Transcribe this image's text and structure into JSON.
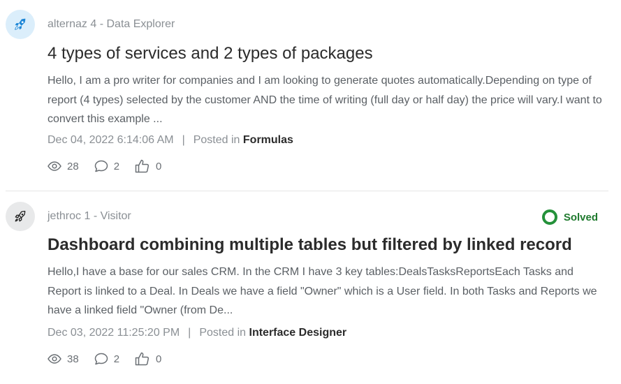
{
  "posts": [
    {
      "author": "alternaz 4 - Data Explorer",
      "title": "4 types of services and 2 types of packages",
      "excerpt": "Hello, I am a pro writer for companies and I am looking to generate quotes automatically.Depending on type of report (4 types) selected by the customer AND the time of writing (full day or half day) the price will vary.I want to convert this example ...",
      "date": "Dec 04, 2022 6:14:06 AM",
      "separator": "|",
      "posted_in_label": "Posted in",
      "category": "Formulas",
      "views": "28",
      "comments": "2",
      "likes": "0",
      "solved": false,
      "avatar_icon": "rocket-icon"
    },
    {
      "author": "jethroc 1 - Visitor",
      "title": "Dashboard combining multiple tables but filtered by linked record",
      "excerpt": "Hello,I have a base for our sales CRM. In the CRM I have 3 key tables:DealsTasksReportsEach Tasks and Report is linked to a Deal. In Deals we have a field \"Owner\" which is a User field. In both Tasks and Reports we have a linked field \"Owner (from De...",
      "date": "Dec 03, 2022 11:25:20 PM",
      "separator": "|",
      "posted_in_label": "Posted in",
      "category": "Interface Designer",
      "views": "38",
      "comments": "2",
      "likes": "0",
      "solved": true,
      "solved_label": "Solved",
      "avatar_icon": "rocket-icon"
    }
  ],
  "colors": {
    "solved_green": "#24913a",
    "author_gray": "#8a8f94",
    "title_dark": "#2b2b2b",
    "avatar_blue_bg": "#dbeefb",
    "avatar_gray_bg": "#e8e9ea"
  }
}
